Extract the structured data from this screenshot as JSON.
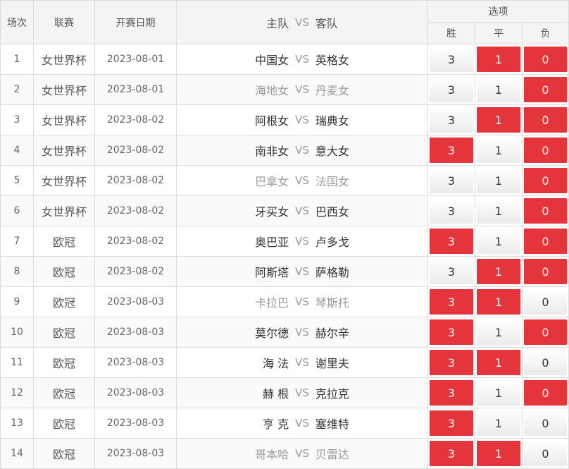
{
  "header": {
    "seq": "场次",
    "league": "联赛",
    "date": "开赛日期",
    "home": "主队",
    "vs": "VS",
    "away": "客队",
    "options": "选项",
    "win": "胜",
    "draw": "平",
    "lose": "负"
  },
  "colors": {
    "selected": "#e3353b",
    "unselected_text": "#333333",
    "muted_team": "#9a9a9a"
  },
  "rows": [
    {
      "seq": "1",
      "league": "女世界杯",
      "date": "2023-08-01",
      "home": "中国女",
      "vs": "VS",
      "away": "英格女",
      "muted": false,
      "win": "3",
      "draw": "1",
      "lose": "0",
      "sel": [
        false,
        true,
        true
      ]
    },
    {
      "seq": "2",
      "league": "女世界杯",
      "date": "2023-08-01",
      "home": "海地女",
      "vs": "VS",
      "away": "丹麦女",
      "muted": true,
      "win": "3",
      "draw": "1",
      "lose": "0",
      "sel": [
        false,
        false,
        true
      ]
    },
    {
      "seq": "3",
      "league": "女世界杯",
      "date": "2023-08-02",
      "home": "阿根女",
      "vs": "VS",
      "away": "瑞典女",
      "muted": false,
      "win": "3",
      "draw": "1",
      "lose": "0",
      "sel": [
        false,
        true,
        true
      ]
    },
    {
      "seq": "4",
      "league": "女世界杯",
      "date": "2023-08-02",
      "home": "南非女",
      "vs": "VS",
      "away": "意大女",
      "muted": false,
      "win": "3",
      "draw": "1",
      "lose": "0",
      "sel": [
        true,
        false,
        true
      ]
    },
    {
      "seq": "5",
      "league": "女世界杯",
      "date": "2023-08-02",
      "home": "巴拿女",
      "vs": "VS",
      "away": "法国女",
      "muted": true,
      "win": "3",
      "draw": "1",
      "lose": "0",
      "sel": [
        false,
        false,
        true
      ]
    },
    {
      "seq": "6",
      "league": "女世界杯",
      "date": "2023-08-02",
      "home": "牙买女",
      "vs": "VS",
      "away": "巴西女",
      "muted": false,
      "win": "3",
      "draw": "1",
      "lose": "0",
      "sel": [
        false,
        false,
        true
      ]
    },
    {
      "seq": "7",
      "league": "欧冠",
      "date": "2023-08-02",
      "home": "奥巴亚",
      "vs": "VS",
      "away": "卢多戈",
      "muted": false,
      "win": "3",
      "draw": "1",
      "lose": "0",
      "sel": [
        true,
        false,
        true
      ]
    },
    {
      "seq": "8",
      "league": "欧冠",
      "date": "2023-08-02",
      "home": "阿斯塔",
      "vs": "VS",
      "away": "萨格勒",
      "muted": false,
      "win": "3",
      "draw": "1",
      "lose": "0",
      "sel": [
        false,
        true,
        true
      ]
    },
    {
      "seq": "9",
      "league": "欧冠",
      "date": "2023-08-03",
      "home": "卡拉巴",
      "vs": "VS",
      "away": "琴斯托",
      "muted": true,
      "win": "3",
      "draw": "1",
      "lose": "0",
      "sel": [
        true,
        true,
        false
      ]
    },
    {
      "seq": "10",
      "league": "欧冠",
      "date": "2023-08-03",
      "home": "莫尔德",
      "vs": "VS",
      "away": "赫尔辛",
      "muted": false,
      "win": "3",
      "draw": "1",
      "lose": "0",
      "sel": [
        true,
        false,
        true
      ]
    },
    {
      "seq": "11",
      "league": "欧冠",
      "date": "2023-08-03",
      "home": "海 法",
      "vs": "VS",
      "away": "谢里夫",
      "muted": false,
      "win": "3",
      "draw": "1",
      "lose": "0",
      "sel": [
        true,
        true,
        false
      ]
    },
    {
      "seq": "12",
      "league": "欧冠",
      "date": "2023-08-03",
      "home": "赫 根",
      "vs": "VS",
      "away": "克拉克",
      "muted": false,
      "win": "3",
      "draw": "1",
      "lose": "0",
      "sel": [
        true,
        false,
        true
      ]
    },
    {
      "seq": "13",
      "league": "欧冠",
      "date": "2023-08-03",
      "home": "亨 克",
      "vs": "VS",
      "away": "塞维特",
      "muted": false,
      "win": "3",
      "draw": "1",
      "lose": "0",
      "sel": [
        true,
        false,
        false
      ]
    },
    {
      "seq": "14",
      "league": "欧冠",
      "date": "2023-08-03",
      "home": "哥本哈",
      "vs": "VS",
      "away": "贝雷达",
      "muted": true,
      "win": "3",
      "draw": "1",
      "lose": "0",
      "sel": [
        true,
        true,
        false
      ]
    }
  ]
}
